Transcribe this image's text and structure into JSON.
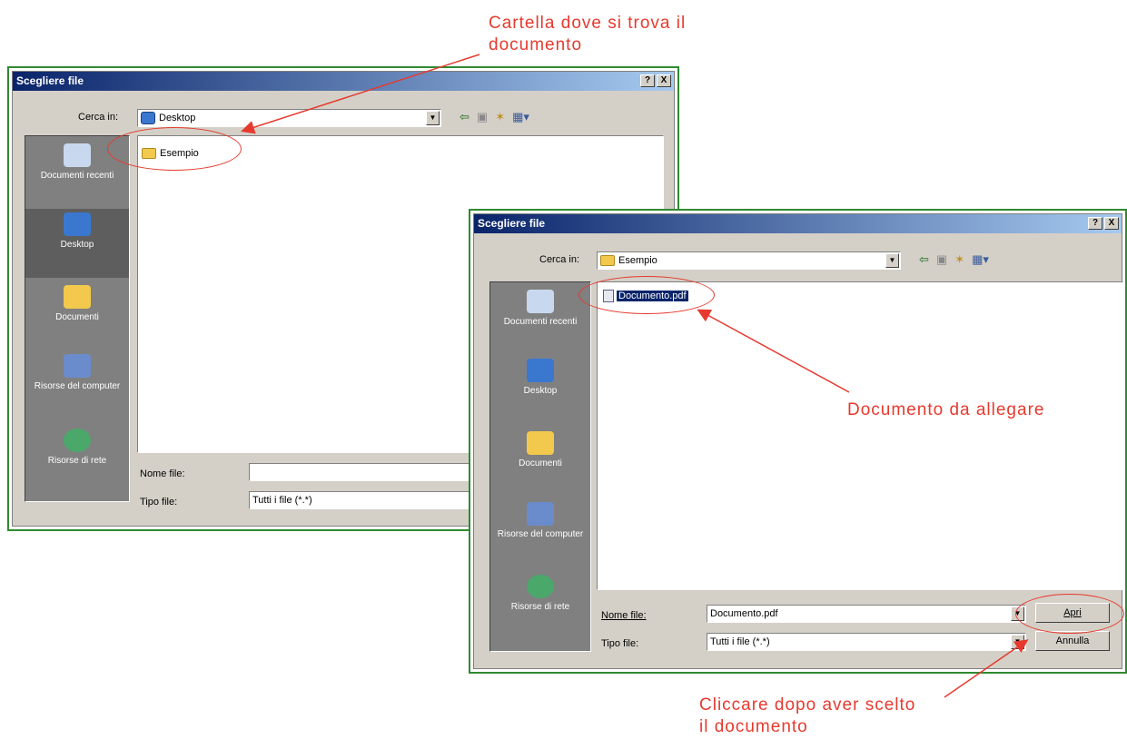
{
  "dialog1": {
    "title": "Scegliere file",
    "help_btn": "?",
    "close_btn": "X",
    "lookin_label": "Cerca in:",
    "lookin_value": "Desktop",
    "places": [
      "Documenti recenti",
      "Desktop",
      "Documenti",
      "Risorse del computer",
      "Risorse di rete"
    ],
    "files": [
      "Esempio"
    ],
    "filename_label": "Nome file:",
    "filename_value": "",
    "filetype_label": "Tipo file:",
    "filetype_value": "Tutti i file (*.*)"
  },
  "dialog2": {
    "title": "Scegliere file",
    "help_btn": "?",
    "close_btn": "X",
    "lookin_label": "Cerca in:",
    "lookin_value": "Esempio",
    "places": [
      "Documenti recenti",
      "Desktop",
      "Documenti",
      "Risorse del computer",
      "Risorse di rete"
    ],
    "files": [
      "Documento.pdf"
    ],
    "filename_label": "Nome file:",
    "filename_value": "Documento.pdf",
    "filetype_label": "Tipo file:",
    "filetype_value": "Tutti i file (*.*)",
    "open_btn": "Apri",
    "cancel_btn": "Annulla"
  },
  "annotations": {
    "folder_note": "Cartella dove si trova il documento",
    "doc_note": "Documento da allegare",
    "click_note": "Cliccare dopo aver scelto il documento"
  },
  "icons": {
    "back": "back-arrow-icon",
    "up": "up-folder-icon",
    "new_folder": "new-folder-icon",
    "views": "views-menu-icon"
  },
  "colors": {
    "annotation": "#e63a2e",
    "frame": "#2f8a2f",
    "titlebar": "#0a246a"
  }
}
